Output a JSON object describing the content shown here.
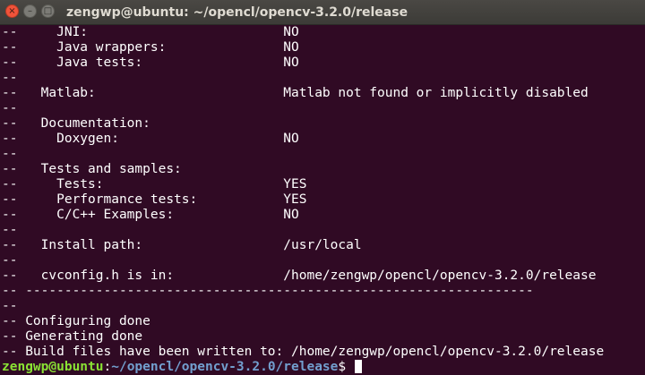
{
  "window": {
    "title": "zengwp@ubuntu: ~/opencl/opencv-3.2.0/release",
    "close_icon": "×",
    "minimize_icon": "–",
    "maximize_icon": "□"
  },
  "terminal": {
    "background": "#300a24",
    "lines": [
      "--     JNI:                         NO",
      "--     Java wrappers:               NO",
      "--     Java tests:                  NO",
      "--",
      "--   Matlab:                        Matlab not found or implicitly disabled",
      "--",
      "--   Documentation:",
      "--     Doxygen:                     NO",
      "--",
      "--   Tests and samples:",
      "--     Tests:                       YES",
      "--     Performance tests:           YES",
      "--     C/C++ Examples:              NO",
      "--",
      "--   Install path:                  /usr/local",
      "--",
      "--   cvconfig.h is in:              /home/zengwp/opencl/opencv-3.2.0/release",
      "-- -----------------------------------------------------------------",
      "--",
      "-- Configuring done",
      "-- Generating done",
      "-- Build files have been written to: /home/zengwp/opencl/opencv-3.2.0/release"
    ],
    "prompt": {
      "user_host": "zengwp@ubuntu",
      "separator": ":",
      "path": "~/opencl/opencv-3.2.0/release",
      "symbol": "$ "
    }
  }
}
